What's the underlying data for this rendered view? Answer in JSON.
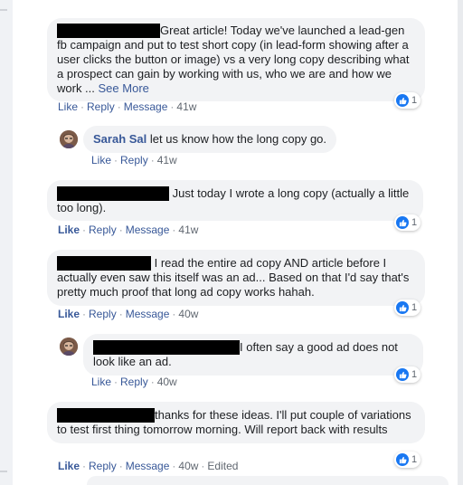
{
  "comments": [
    {
      "text": "Great article! Today we've launched a lead-gen fb campaign and put to test short copy (in lead-form showing after a user clicks the button or image) vs a very long copy describing what a prospect can gain by working with us, who we are and how we work ... ",
      "see_more": "See More",
      "actions": {
        "like": "Like",
        "reply": "Reply",
        "message": "Message",
        "time": "41w"
      },
      "reaction_count": "1"
    },
    {
      "author": "Sarah Sal",
      "text": "let us know how the long copy go.",
      "actions": {
        "like": "Like",
        "reply": "Reply",
        "time": "41w"
      }
    },
    {
      "text": "Just today I wrote a long copy (actually a little too long).",
      "actions": {
        "like": "Like",
        "reply": "Reply",
        "message": "Message",
        "time": "41w"
      },
      "reaction_count": "1"
    },
    {
      "text": "I read the entire ad copy AND article before I actually even saw this itself was an ad... Based on that I'd say that's pretty much proof that long ad copy works hahah.",
      "actions": {
        "like": "Like",
        "reply": "Reply",
        "message": "Message",
        "time": "40w"
      },
      "reaction_count": "1"
    },
    {
      "text": "I often say a good ad does not look like an ad.",
      "actions": {
        "like": "Like",
        "reply": "Reply",
        "time": "40w"
      },
      "reaction_count": "1"
    },
    {
      "text": "thanks for these ideas. I'll put couple of variations to test first thing tomorrow morning. Will report back with results",
      "actions": {
        "like": "Like",
        "reply": "Reply",
        "message": "Message",
        "time": "40w",
        "edited": "Edited"
      },
      "reaction_count": "1"
    }
  ],
  "colors": {
    "link": "#385898",
    "like_blue": "#1877f2",
    "bubble": "#f2f3f5",
    "meta": "#606770"
  },
  "icons": [
    "like-thumb-icon",
    "avatar"
  ]
}
